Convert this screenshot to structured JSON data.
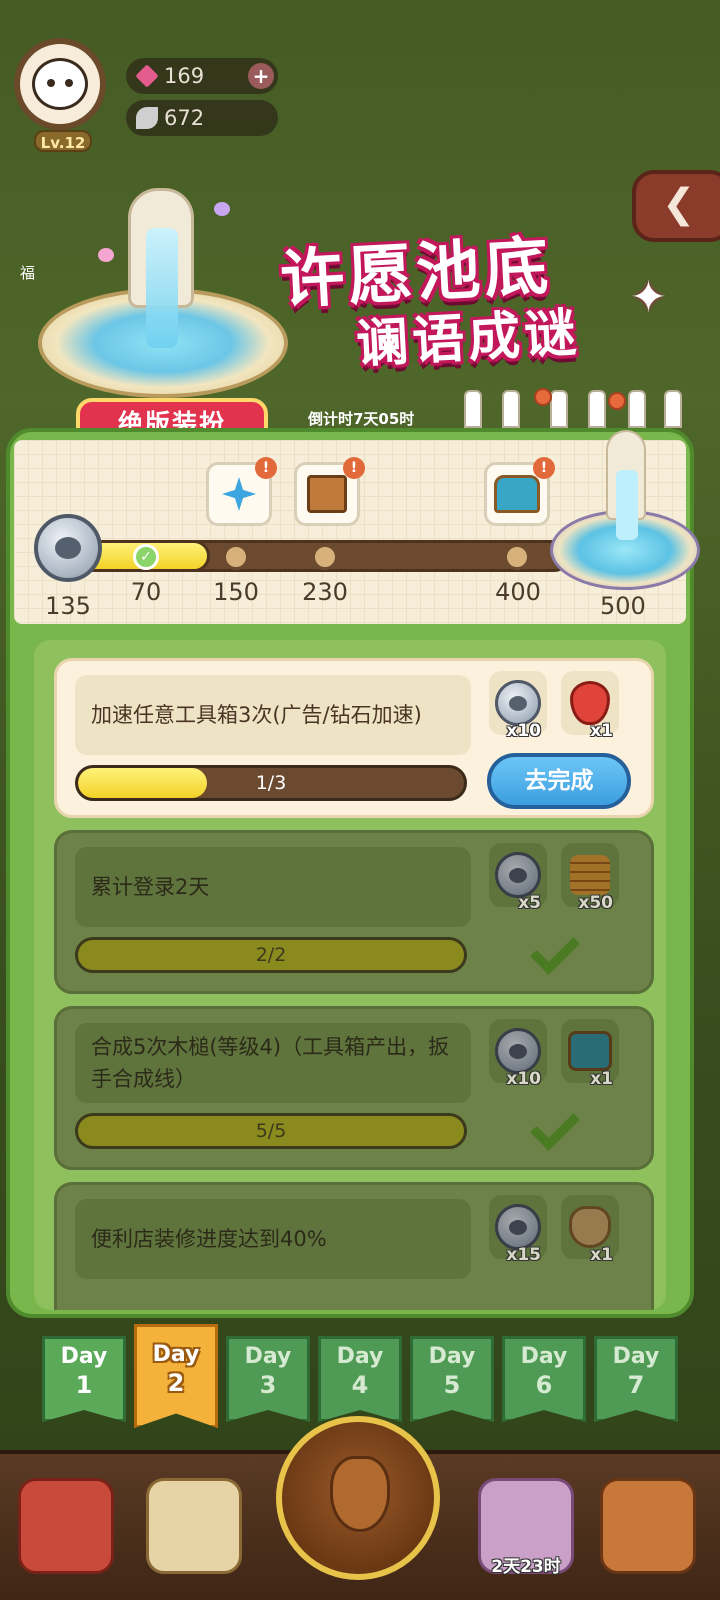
{
  "hud": {
    "level": "Lv.12",
    "gems": "169",
    "leaves": "672",
    "side_label": "福"
  },
  "event": {
    "title_line1": "许愿池底",
    "title_line2": "谰语成谜",
    "badge": "绝版装扮",
    "countdown": "倒计时7天05时"
  },
  "milestones": {
    "current_points": "135",
    "labels": [
      "70",
      "150",
      "230",
      "400",
      "500"
    ],
    "progress_fraction": 0.28
  },
  "tasks": [
    {
      "description": "加速任意工具箱3次(广告/钻石加速)",
      "progress_text": "1/3",
      "progress_fraction": 0.333,
      "rewards": [
        {
          "icon": "paw-coin-icon",
          "qty": "x10"
        },
        {
          "icon": "strawberry-icon",
          "qty": "x1"
        }
      ],
      "action": "去完成",
      "status": "active"
    },
    {
      "description": "累计登录2天",
      "progress_text": "2/2",
      "progress_fraction": 1,
      "rewards": [
        {
          "icon": "paw-coin-icon",
          "qty": "x5"
        },
        {
          "icon": "gold-coins-icon",
          "qty": "x50"
        }
      ],
      "status": "completed"
    },
    {
      "description": "合成5次木槌(等级4)（工具箱产出，扳手合成线）",
      "progress_text": "5/5",
      "progress_fraction": 1,
      "rewards": [
        {
          "icon": "paw-coin-icon",
          "qty": "x10"
        },
        {
          "icon": "toolbox-chest-icon",
          "qty": "x1"
        }
      ],
      "status": "completed"
    },
    {
      "description": "便利店装修进度达到40%",
      "progress_text": "",
      "rewards": [
        {
          "icon": "paw-coin-icon",
          "qty": "x15"
        },
        {
          "icon": "seed-sack-icon",
          "qty": "x1"
        }
      ],
      "status": "completed"
    }
  ],
  "days": [
    {
      "word": "Day",
      "num": "1",
      "state": "past"
    },
    {
      "word": "Day",
      "num": "2",
      "state": "current"
    },
    {
      "word": "Day",
      "num": "3",
      "state": "locked"
    },
    {
      "word": "Day",
      "num": "4",
      "state": "locked"
    },
    {
      "word": "Day",
      "num": "5",
      "state": "locked"
    },
    {
      "word": "Day",
      "num": "6",
      "state": "locked"
    },
    {
      "word": "Day",
      "num": "7",
      "state": "locked"
    }
  ],
  "bottom_nav": {
    "timer": "2天23时"
  },
  "colors": {
    "panel_green": "#79b64c",
    "title_pink": "#c2185b",
    "go_button_blue": "#3d9ee0",
    "current_day_orange": "#f4b23a"
  }
}
